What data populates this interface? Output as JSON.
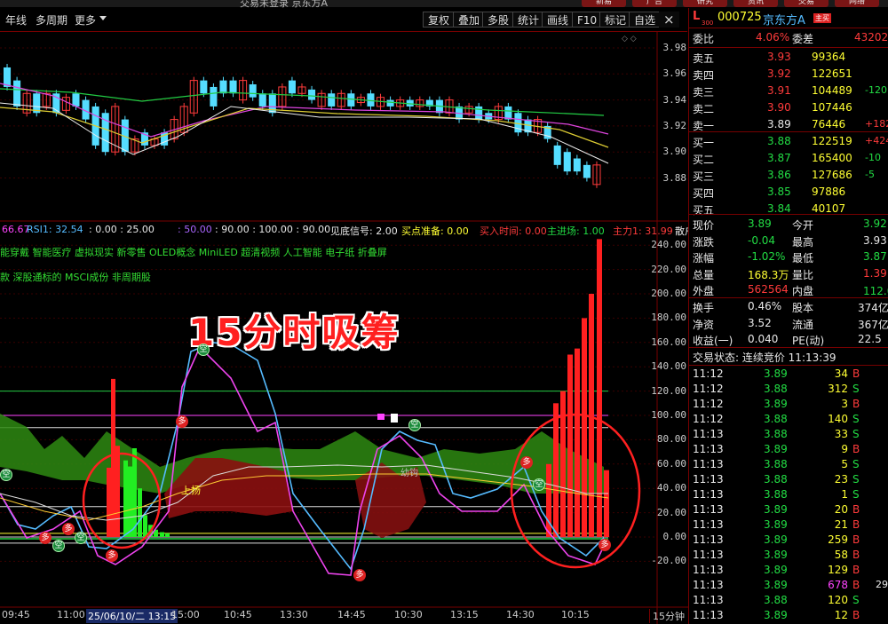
{
  "window": {
    "title": "交易未登录  京东方A",
    "tabs": [
      "新易",
      "广告",
      "研究",
      "资讯",
      "交易",
      "网络"
    ]
  },
  "toolbar": {
    "left_items": [
      "年线",
      "多周期",
      "更多"
    ],
    "buttons": [
      "复权",
      "叠加",
      "多股",
      "统计",
      "画线",
      "F10",
      "标记",
      "自选"
    ],
    "close_glyph": "×"
  },
  "chart": {
    "price_axis": [
      "3.98",
      "3.96",
      "3.94",
      "3.92",
      "3.90",
      "3.88"
    ],
    "indicator_axis": [
      "240.00",
      "220.00",
      "200.00",
      "180.00",
      "160.00",
      "140.00",
      "120.00",
      "100.00",
      "80.00",
      "60.00",
      "40.00",
      "20.00",
      "0.00",
      "-20.00"
    ],
    "indicator_items": [
      {
        "text": "66.67",
        "color": "#ff44ff"
      },
      {
        "text": "RSI1: 32.54",
        "color": "#55bbff"
      },
      {
        "text": ": 0.00 : 25.00",
        "color": "#e8e8e8"
      },
      {
        "text": ": 50.00",
        "color": "#aa66ff"
      },
      {
        "text": ": 90.00 : 100.00 : 90.00",
        "color": "#e8e8e8"
      },
      {
        "text": "见底信号: 2.00",
        "color": "#e8e8e8"
      },
      {
        "text": "买点准备: 0.00",
        "color": "#ffff33"
      },
      {
        "text": "买入时间: 0.00",
        "color": "#ff3b3b"
      },
      {
        "text": "主进场: 1.00",
        "color": "#22dd44"
      },
      {
        "text": "主力1: 31.99",
        "color": "#ff3b3b"
      },
      {
        "text": "散户",
        "color": "#e8e8e8"
      }
    ],
    "concepts_line1": "能穿戴 智能医疗 虚拟现实 新零售 OLED概念 MiniLED 超清视频 人工智能 电子纸 折叠屏",
    "concepts_line2": "款 深股通标的 MSCI成份 非周期股",
    "overlay_title": "15分时吸筹",
    "chart_tags": {
      "shangyang": "上扬",
      "chuang": "幼钩"
    },
    "badges": {
      "duo": "多",
      "kong": "空"
    },
    "x_labels": [
      "09:45",
      "11:00",
      "25/06/10/二 13:15",
      "15:00",
      "10:45",
      "13:30",
      "14:45",
      "10:30",
      "13:15",
      "14:30",
      "10:15"
    ],
    "period": "15分钟"
  },
  "quote": {
    "marker": "L",
    "marker_sub": "300",
    "code": "000725",
    "name": "京东方A",
    "tag": "主买",
    "weibi_label": "委比",
    "weibi_value": "4.06%",
    "weicha_label": "委差",
    "weicha_value": "43202",
    "asks": [
      {
        "label": "卖五",
        "price": "3.93",
        "vol": "99364",
        "chg": ""
      },
      {
        "label": "卖四",
        "price": "3.92",
        "vol": "122651",
        "chg": ""
      },
      {
        "label": "卖三",
        "price": "3.91",
        "vol": "104489",
        "chg": "-120"
      },
      {
        "label": "卖二",
        "price": "3.90",
        "vol": "107446",
        "chg": ""
      },
      {
        "label": "卖一",
        "price": "3.89",
        "vol": "76446",
        "chg": "+182"
      }
    ],
    "bids": [
      {
        "label": "买一",
        "price": "3.88",
        "vol": "122519",
        "chg": "+424"
      },
      {
        "label": "买二",
        "price": "3.87",
        "vol": "165400",
        "chg": "-10"
      },
      {
        "label": "买三",
        "price": "3.86",
        "vol": "127686",
        "chg": "-5"
      },
      {
        "label": "买四",
        "price": "3.85",
        "vol": "97886",
        "chg": ""
      },
      {
        "label": "买五",
        "price": "3.84",
        "vol": "40107",
        "chg": ""
      }
    ],
    "stats": [
      {
        "l1": "现价",
        "v1": "3.89",
        "l2": "今开",
        "v2": "3.92",
        "c1": "#22dd44",
        "c2": "#22dd44"
      },
      {
        "l1": "涨跌",
        "v1": "-0.04",
        "l2": "最高",
        "v2": "3.93",
        "c1": "#22dd44",
        "c2": "#e8e8e8"
      },
      {
        "l1": "涨幅",
        "v1": "-1.02%",
        "l2": "最低",
        "v2": "3.87",
        "c1": "#22dd44",
        "c2": "#22dd44"
      },
      {
        "l1": "总量",
        "v1": "168.3万",
        "l2": "量比",
        "v2": "1.39",
        "c1": "#ffff33",
        "c2": "#ff3b3b"
      },
      {
        "l1": "外盘",
        "v1": "562564",
        "l2": "内盘",
        "v2": "112.0万",
        "c1": "#ff3b3b",
        "c2": "#22dd44"
      }
    ],
    "stats2": [
      {
        "l1": "换手",
        "v1": "0.46%",
        "l2": "股本",
        "v2": "374亿"
      },
      {
        "l1": "净资",
        "v1": "3.52",
        "l2": "流通",
        "v2": "367亿"
      },
      {
        "l1": "收益(一)",
        "v1": "0.040",
        "l2": "PE(动)",
        "v2": "22.5"
      }
    ],
    "trade_status": "交易状态: 连续竞价 11:13:39",
    "trades": [
      {
        "t": "11:12",
        "p": "3.89",
        "v": "34",
        "s": "B",
        "pc": "#22dd44",
        "vc": "#ffff33",
        "sc": "#ff3b3b"
      },
      {
        "t": "11:12",
        "p": "3.88",
        "v": "312",
        "s": "S",
        "pc": "#22dd44",
        "vc": "#ffff33",
        "sc": "#22dd44"
      },
      {
        "t": "11:12",
        "p": "3.89",
        "v": "3",
        "s": "B",
        "pc": "#22dd44",
        "vc": "#ffff33",
        "sc": "#ff3b3b"
      },
      {
        "t": "11:12",
        "p": "3.88",
        "v": "140",
        "s": "S",
        "pc": "#22dd44",
        "vc": "#ffff33",
        "sc": "#22dd44"
      },
      {
        "t": "11:13",
        "p": "3.88",
        "v": "33",
        "s": "S",
        "pc": "#22dd44",
        "vc": "#ffff33",
        "sc": "#22dd44"
      },
      {
        "t": "11:13",
        "p": "3.89",
        "v": "9",
        "s": "B",
        "pc": "#22dd44",
        "vc": "#ffff33",
        "sc": "#ff3b3b"
      },
      {
        "t": "11:13",
        "p": "3.88",
        "v": "5",
        "s": "S",
        "pc": "#22dd44",
        "vc": "#ffff33",
        "sc": "#22dd44"
      },
      {
        "t": "11:13",
        "p": "3.88",
        "v": "23",
        "s": "S",
        "pc": "#22dd44",
        "vc": "#ffff33",
        "sc": "#22dd44"
      },
      {
        "t": "11:13",
        "p": "3.88",
        "v": "1",
        "s": "S",
        "pc": "#22dd44",
        "vc": "#ffff33",
        "sc": "#22dd44"
      },
      {
        "t": "11:13",
        "p": "3.89",
        "v": "20",
        "s": "B",
        "pc": "#22dd44",
        "vc": "#ffff33",
        "sc": "#ff3b3b"
      },
      {
        "t": "11:13",
        "p": "3.89",
        "v": "21",
        "s": "B",
        "pc": "#22dd44",
        "vc": "#ffff33",
        "sc": "#ff3b3b"
      },
      {
        "t": "11:13",
        "p": "3.89",
        "v": "259",
        "s": "B",
        "pc": "#22dd44",
        "vc": "#ffff33",
        "sc": "#ff3b3b"
      },
      {
        "t": "11:13",
        "p": "3.89",
        "v": "58",
        "s": "B",
        "pc": "#22dd44",
        "vc": "#ffff33",
        "sc": "#ff3b3b"
      },
      {
        "t": "11:13",
        "p": "3.89",
        "v": "129",
        "s": "B",
        "pc": "#22dd44",
        "vc": "#ffff33",
        "sc": "#ff3b3b"
      },
      {
        "t": "11:13",
        "p": "3.89",
        "v": "678",
        "s": "B",
        "pc": "#22dd44",
        "vc": "#ff44ff",
        "sc": "#ff3b3b"
      },
      {
        "t": "11:13",
        "p": "3.88",
        "v": "120",
        "s": "S",
        "pc": "#22dd44",
        "vc": "#ffff33",
        "sc": "#22dd44"
      },
      {
        "t": "11:13",
        "p": "3.89",
        "v": "12",
        "s": "B",
        "pc": "#22dd44",
        "vc": "#ffff33",
        "sc": "#ff3b3b"
      }
    ],
    "trade_extra": [
      "",
      "",
      "",
      "",
      "",
      "",
      "",
      "",
      "",
      "",
      "",
      "",
      "",
      "",
      "29",
      "",
      ""
    ]
  },
  "colors": {
    "up": "#ff3b3b",
    "down": "#22dd44",
    "accent": "#700000",
    "candle_down": "#55ddff"
  }
}
